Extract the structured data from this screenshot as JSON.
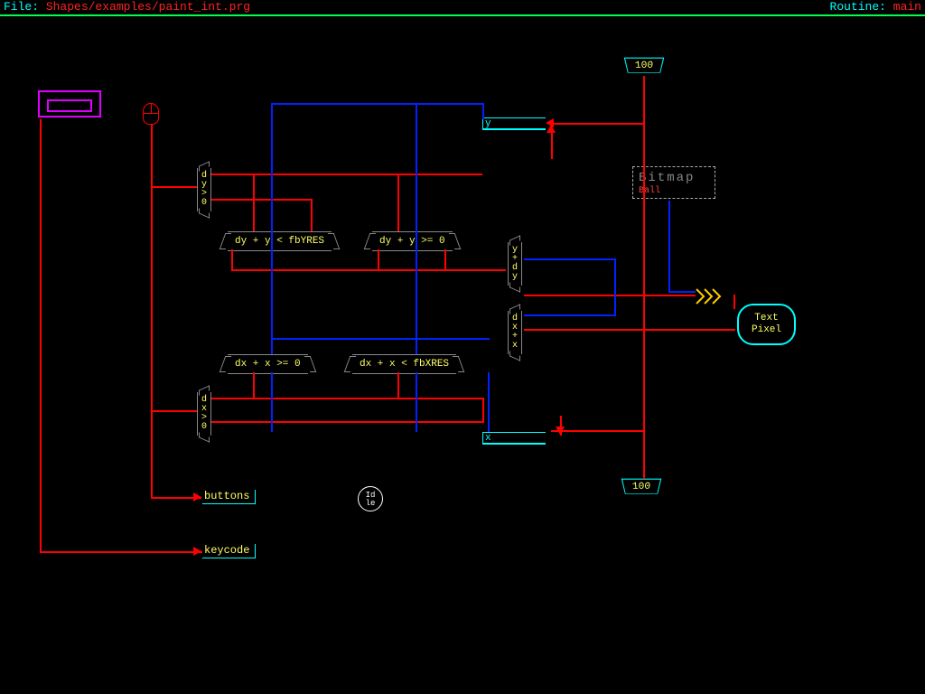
{
  "header": {
    "file_label": "File:",
    "file_path": "Shapes/examples/paint_int.prg",
    "routine_label": "Routine:",
    "routine_name": "main"
  },
  "weights": {
    "top": "100",
    "bottom": "100"
  },
  "conditions": {
    "dy_gt_0": "d\ny\n>\n0",
    "dx_gt_0": "d\nx\n>\n0",
    "dy_y_lt_yres": "dy + y < fbYRES",
    "dy_y_ge_0": "dy + y >= 0",
    "dx_x_ge_0": "dx + x >= 0",
    "dx_x_lt_xres": "dx + x < fbXRES",
    "y_plus_dy": "y\n+\nd\ny",
    "x_plus_dx": "d\nx\n+\nx"
  },
  "ports": {
    "y": "y",
    "x": "x"
  },
  "terminals": {
    "buttons": "buttons",
    "keycode": "keycode"
  },
  "bitmap": {
    "title": "Bitmap",
    "subtitle": "Ball"
  },
  "output": {
    "line1": "Text",
    "line2": "Pixel"
  },
  "idle": "Id\nle"
}
